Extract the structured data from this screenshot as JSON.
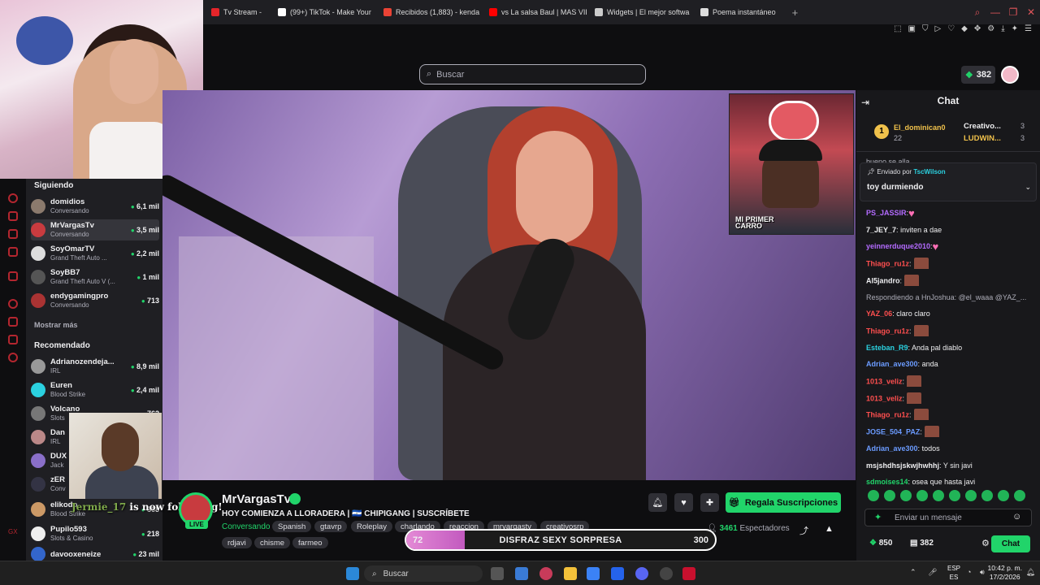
{
  "browser": {
    "tabs": [
      {
        "label": "Tv Stream - ",
        "color": "#e5252a"
      },
      {
        "label": "(99+) TikTok - Make Your ",
        "color": "#ffffff"
      },
      {
        "label": "Recibidos (1,883) - kenda",
        "color": "#ea4335"
      },
      {
        "label": "vs La salsa Baul | MAS VIP",
        "color": "#ff0000"
      },
      {
        "label": "Widgets | El mejor softwa",
        "color": "#cccccc"
      },
      {
        "label": "Poema instantáneo",
        "color": "#dddddd"
      }
    ],
    "new_tab": "+"
  },
  "header": {
    "search_placeholder": "Buscar",
    "points": "382"
  },
  "sidebar": {
    "following_title": "Siguiendo",
    "following": [
      {
        "name": "domidios",
        "category": "Conversando",
        "viewers": "6,1 mil"
      },
      {
        "name": "MrVargasTv",
        "category": "Conversando",
        "viewers": "3,5 mil"
      },
      {
        "name": "SoyOmarTV",
        "category": "Grand Theft Auto ...",
        "viewers": "2,2 mil"
      },
      {
        "name": "SoyBB7",
        "category": "Grand Theft Auto V (...",
        "viewers": "1 mil"
      },
      {
        "name": "endygamingpro",
        "category": "Conversando",
        "viewers": "713"
      }
    ],
    "show_more": "Mostrar más",
    "recommended_title": "Recomendado",
    "recommended": [
      {
        "name": "Adrianozendeja...",
        "category": "IRL",
        "viewers": "8,9 mil"
      },
      {
        "name": "Euren",
        "category": "Blood Strike",
        "viewers": "2,4 mil"
      },
      {
        "name": "Volcano",
        "category": "Slots",
        "viewers": "762"
      },
      {
        "name": "Dan",
        "category": "IRL",
        "viewers": ""
      },
      {
        "name": "DUX",
        "category": "Jack",
        "viewers": ""
      },
      {
        "name": "zER",
        "category": "Conv",
        "viewers": ""
      },
      {
        "name": "elikodo",
        "category": "Blood Strike",
        "viewers": "368"
      },
      {
        "name": "Pupilo593",
        "category": "Slots & Casino",
        "viewers": "218"
      },
      {
        "name": "davooxeneize",
        "category": "",
        "viewers": "23 mil"
      }
    ]
  },
  "alert": {
    "follower": "Jermie_17",
    "text": " is now following!"
  },
  "stream": {
    "pip_caption_1": "MI PRIMER",
    "pip_caption_2": "CARRO",
    "channel_name": "MrVargasTv",
    "live": "LIVE",
    "title": "HOY COMIENZA A LLORADERA  |  🇸🇻 CHIPIGANG | SUSCRÍBETE",
    "category": "Conversando",
    "tags": [
      "Spanish",
      "gtavrp",
      "Roleplay",
      "charlando",
      "reaccion",
      "mrvargastv",
      "creativosrp",
      "rdjavi",
      "chisme",
      "farmeo"
    ],
    "gift_button": "Regala Suscripciones",
    "viewers_count": "3461",
    "viewers_label": " Espectadores"
  },
  "poll": {
    "left_value": "72",
    "label": "DISFRAZ SEXY SORPRESA",
    "right_value": "300",
    "fill_fraction": 0.19
  },
  "chat": {
    "title": "Chat",
    "leaderboard": {
      "top_name": "El_dominican0",
      "top_value": "22",
      "second_name": "Creativo...",
      "second_value": "3",
      "third_name": "LUDWIN...",
      "third_value": "3"
    },
    "partial_line": "bueno se alla",
    "pinned": {
      "sent_by_label": "Enviado por",
      "sender": "TscWilson",
      "message": "toy durmiendo"
    },
    "messages": [
      {
        "user": "PS_JASSIR",
        "color": "#b46bff",
        "text": "",
        "emote": "heart"
      },
      {
        "user": "7_JEY_7",
        "color": "#efeff1",
        "text": " inviten a dae",
        "emote": ""
      },
      {
        "user": "yeinnerduque2010",
        "color": "#b46bff",
        "text": "",
        "emote": "heart"
      },
      {
        "user": "Thiago_ru1z",
        "color": "#ff4f4f",
        "text": "",
        "emote": "img"
      },
      {
        "user": "Al5jandro",
        "color": "#efeff1",
        "text": "",
        "emote": "img"
      },
      {
        "user": "",
        "color": "#adadb8",
        "text": "Respondiendo a HnJoshua: @el_waaa @YAZ_...",
        "emote": ""
      },
      {
        "user": "YAZ_06",
        "color": "#ff4f4f",
        "text": " claro claro",
        "emote": ""
      },
      {
        "user": "Thiago_ru1z",
        "color": "#ff4f4f",
        "text": "",
        "emote": "img"
      },
      {
        "user": "Esteban_R9",
        "color": "#2bd1e0",
        "text": " Anda pal diablo",
        "emote": ""
      },
      {
        "user": "Adrian_ave300",
        "color": "#6b9bff",
        "text": " anda",
        "emote": ""
      },
      {
        "user": "1013_veliz",
        "color": "#ff4f4f",
        "text": "",
        "emote": "img"
      },
      {
        "user": "1013_veliz",
        "color": "#ff4f4f",
        "text": "",
        "emote": "img"
      },
      {
        "user": "Thiago_ru1z",
        "color": "#ff4f4f",
        "text": "",
        "emote": "img"
      },
      {
        "user": "JOSE_504_PAZ",
        "color": "#6b9bff",
        "text": "",
        "emote": "img"
      },
      {
        "user": "Adrian_ave300",
        "color": "#6b9bff",
        "text": " todos",
        "emote": ""
      },
      {
        "user": "msjshdhsjskwjhwhhj",
        "color": "#efeff1",
        "text": " Y sin javi",
        "emote": ""
      },
      {
        "user": "sdmoises14",
        "color": "#21d46a",
        "text": " osea que hasta javi",
        "emote": ""
      }
    ],
    "input_placeholder": "Enviar un mensaje",
    "balance_1": "850",
    "balance_2": "382",
    "send_button": "Chat"
  },
  "taskbar": {
    "search_placeholder": "Buscar",
    "lang_1": "ESP",
    "lang_2": "ES",
    "time": "10:42 p. m.",
    "date": "17/2/2026"
  }
}
